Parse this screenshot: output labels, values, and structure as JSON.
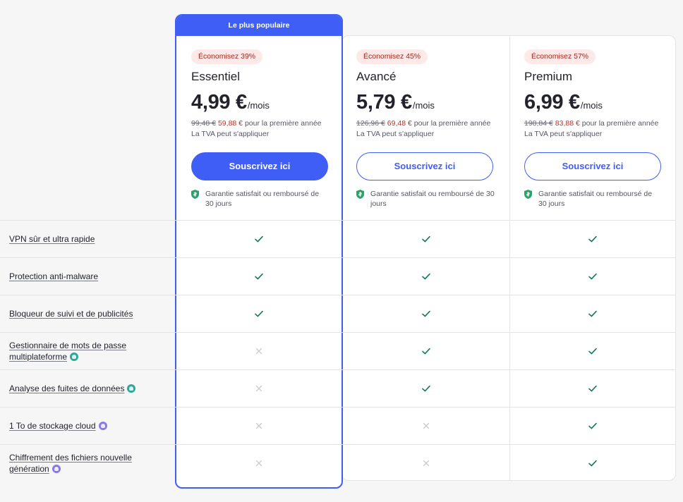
{
  "popular_label": "Le plus populaire",
  "colors": {
    "accent": "#3f5ef6",
    "check": "#11775b",
    "cross": "#c9cad0",
    "badge_bg": "#fde9e8",
    "badge_text": "#a8241c",
    "sale": "#d12a1f"
  },
  "plans": [
    {
      "badge": "Économisez 39%",
      "name": "Essentiel",
      "price": "4,99 €",
      "per": "/mois",
      "old_price": "99,48 €",
      "new_price": "59,88 €",
      "period_text": "pour la première année",
      "vat": "La TVA peut s'appliquer",
      "cta": "Souscrivez ici",
      "guarantee": "Garantie satisfait ou remboursé de 30 jours"
    },
    {
      "badge": "Économisez 45%",
      "name": "Avancé",
      "price": "5,79 €",
      "per": "/mois",
      "old_price": "126,96 €",
      "new_price": "69,48 €",
      "period_text": "pour la première année",
      "vat": "La TVA peut s'appliquer",
      "cta": "Souscrivez ici",
      "guarantee": "Garantie satisfait ou remboursé de 30 jours"
    },
    {
      "badge": "Économisez 57%",
      "name": "Premium",
      "price": "6,99 €",
      "per": "/mois",
      "old_price": "198,84 €",
      "new_price": "83,88 €",
      "period_text": "pour la première année",
      "vat": "La TVA peut s'appliquer",
      "cta": "Souscrivez ici",
      "guarantee": "Garantie satisfait ou remboursé de 30 jours"
    }
  ],
  "features": [
    {
      "label": "VPN sûr et ultra rapide",
      "icon": null,
      "availability": [
        true,
        true,
        true
      ]
    },
    {
      "label": "Protection anti-malware",
      "icon": null,
      "availability": [
        true,
        true,
        true
      ]
    },
    {
      "label": "Bloqueur de suivi et de publicités",
      "icon": null,
      "availability": [
        true,
        true,
        true
      ]
    },
    {
      "label": "Gestionnaire de mots de passe multiplateforme",
      "icon": "password-manager-icon",
      "icon_color": "teal",
      "availability": [
        false,
        true,
        true
      ]
    },
    {
      "label": "Analyse des fuites de données",
      "icon": "data-leak-scanner-icon",
      "icon_color": "teal",
      "availability": [
        false,
        true,
        true
      ]
    },
    {
      "label": "1 To de stockage cloud",
      "icon": "cloud-storage-icon",
      "icon_color": "purple",
      "availability": [
        false,
        false,
        true
      ]
    },
    {
      "label": "Chiffrement des fichiers nouvelle génération",
      "icon": "file-encryption-icon",
      "icon_color": "purple",
      "availability": [
        false,
        false,
        true
      ]
    }
  ]
}
